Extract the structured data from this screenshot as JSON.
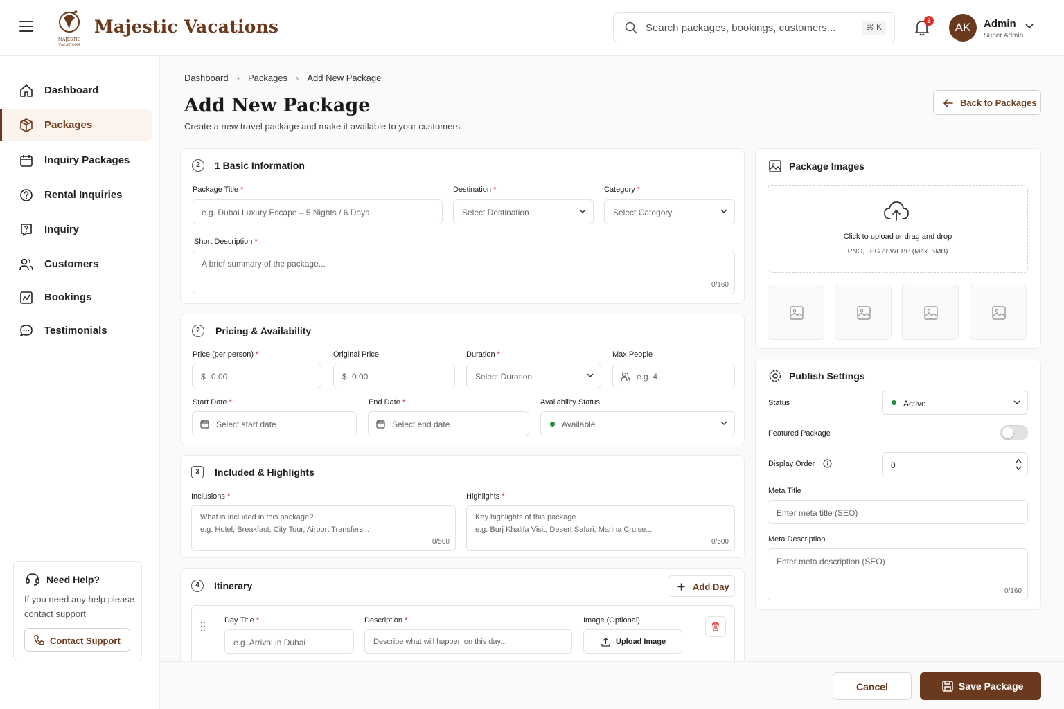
{
  "header": {
    "brand": "Majestic Vacations",
    "logo_small": "MAJESTIC VACATIONS",
    "search_placeholder": "Search packages, bookings, customers...",
    "search_shortcut": "⌘ K",
    "notification_count": "3",
    "avatar_initials": "AK",
    "user_name": "Admin",
    "user_role": "Super Admin"
  },
  "sidebar": {
    "items": [
      {
        "label": "Dashboard",
        "icon": "home-icon"
      },
      {
        "label": "Packages",
        "icon": "package-icon"
      },
      {
        "label": "Inquiry Packages",
        "icon": "calendar-icon"
      },
      {
        "label": "Rental Inquiries",
        "icon": "help-circle-icon"
      },
      {
        "label": "Inquiry",
        "icon": "question-square-icon"
      },
      {
        "label": "Customers",
        "icon": "users-icon"
      },
      {
        "label": "Bookings",
        "icon": "bookings-icon"
      },
      {
        "label": "Testimonials",
        "icon": "chat-icon"
      }
    ],
    "help": {
      "title": "Need Help?",
      "text": "If you need any help please contact support",
      "button": "Contact Support"
    }
  },
  "breadcrumb": [
    "Dashboard",
    "Packages",
    "Add New Package"
  ],
  "page": {
    "title": "Add New Package",
    "subtitle": "Create a new travel package and make it available to your customers.",
    "back_button": "Back to Packages"
  },
  "basic": {
    "number": "2",
    "title": "1  Basic Information",
    "package_title_label": "Package Title",
    "package_title_placeholder": "e.g. Dubai Luxury Escape – 5 Nights / 6 Days",
    "destination_label": "Destination",
    "destination_value": "Select Destination",
    "category_label": "Category",
    "category_value": "Select Category",
    "short_desc_label": "Short Description",
    "short_desc_placeholder": "A brief summary of the package...",
    "short_desc_counter": "0/160"
  },
  "pricing": {
    "number": "2",
    "title": "Pricing & Availability",
    "price_label": "Price (per person)",
    "price_currency": "$",
    "price_placeholder": "0.00",
    "original_label": "Original Price",
    "original_currency": "$",
    "original_placeholder": "0.00",
    "duration_label": "Duration",
    "duration_value": "Select Duration",
    "max_label": "Max People",
    "max_placeholder": "e.g. 4",
    "start_label": "Start Date",
    "start_placeholder": "Select start date",
    "end_label": "End Date",
    "end_placeholder": "Select end date",
    "availability_label": "Availability Status",
    "availability_value": "Available"
  },
  "included": {
    "number": "3",
    "title": "Included & Highlights",
    "inclusions_label": "Inclusions",
    "inclusions_line1": "What is included in this package?",
    "inclusions_line2": "e.g. Hotel, Breakfast, City Tour, Airport Transfers...",
    "inclusions_counter": "0/500",
    "highlights_label": "Highlights",
    "highlights_line1": "Key highlights of this package",
    "highlights_line2": "e.g. Burj Khalifa Visit, Desert Safari, Marina Cruise...",
    "highlights_counter": "0/500"
  },
  "itinerary": {
    "number": "4",
    "title": "Itinerary",
    "add_day": "Add Day",
    "day_title_label": "Day Title",
    "day_title_placeholder": "e.g. Arrival in Dubai",
    "description_label": "Description",
    "description_placeholder": "Describe what will happen on this day...",
    "image_label": "Image (Optional)",
    "upload_button": "Upload Image"
  },
  "images": {
    "title": "Package Images",
    "upload_text": "Click to upload or drag and drop",
    "upload_hint": "PNG, JPG or WEBP (Max. 5MB)"
  },
  "publish": {
    "title": "Publish Settings",
    "status_label": "Status",
    "status_value": "Active",
    "featured_label": "Featured Package",
    "display_order_label": "Display Order",
    "display_order_value": "0",
    "meta_title_label": "Meta Title",
    "meta_title_placeholder": "Enter meta title (SEO)",
    "meta_desc_label": "Meta Description",
    "meta_desc_placeholder": "Enter meta description (SEO)",
    "meta_desc_counter": "0/160"
  },
  "footer": {
    "cancel": "Cancel",
    "save": "Save Package"
  },
  "colors": {
    "brand": "#6b3a1e",
    "active_bg": "#fbf3ec",
    "status_green": "#1e8e3e",
    "required": "#c0392b",
    "badge": "#d93025"
  }
}
